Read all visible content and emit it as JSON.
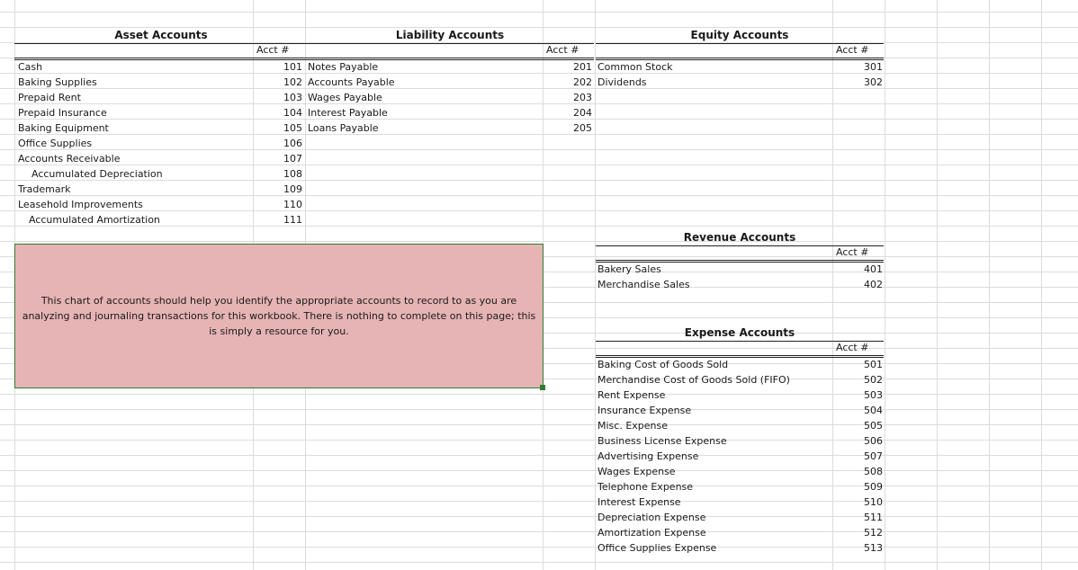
{
  "asset": {
    "title": "Asset Accounts",
    "acct_label": "Acct #",
    "rows": [
      {
        "name": "Cash",
        "num": "101"
      },
      {
        "name": "Baking Supplies",
        "num": "102"
      },
      {
        "name": "Prepaid Rent",
        "num": "103"
      },
      {
        "name": "Prepaid Insurance",
        "num": "104"
      },
      {
        "name": "Baking Equipment",
        "num": "105"
      },
      {
        "name": "Office Supplies",
        "num": "106"
      },
      {
        "name": "Accounts Receivable",
        "num": "107"
      },
      {
        "name": "Accumulated Depreciation",
        "num": "108"
      },
      {
        "name": "Trademark",
        "num": "109"
      },
      {
        "name": "Leasehold Improvements",
        "num": "110"
      },
      {
        "name": "Accumulated Amortization",
        "num": "111"
      }
    ]
  },
  "liability": {
    "title": "Liability Accounts",
    "acct_label": "Acct #",
    "rows": [
      {
        "name": "Notes Payable",
        "num": "201"
      },
      {
        "name": "Accounts Payable",
        "num": "202"
      },
      {
        "name": "Wages Payable",
        "num": "203"
      },
      {
        "name": "Interest Payable",
        "num": "204"
      },
      {
        "name": "Loans Payable",
        "num": "205"
      }
    ]
  },
  "equity": {
    "title": "Equity Accounts",
    "acct_label": "Acct #",
    "rows": [
      {
        "name": "Common Stock",
        "num": "301"
      },
      {
        "name": "Dividends",
        "num": "302"
      }
    ]
  },
  "revenue": {
    "title": "Revenue Accounts",
    "acct_label": "Acct #",
    "rows": [
      {
        "name": "Bakery Sales",
        "num": "401"
      },
      {
        "name": "Merchandise Sales",
        "num": "402"
      }
    ]
  },
  "expense": {
    "title": "Expense Accounts",
    "acct_label": "Acct #",
    "rows": [
      {
        "name": "Baking Cost of Goods Sold",
        "num": "501"
      },
      {
        "name": "Merchandise Cost of Goods Sold (FIFO)",
        "num": "502"
      },
      {
        "name": "Rent Expense",
        "num": "503"
      },
      {
        "name": "Insurance Expense",
        "num": "504"
      },
      {
        "name": "Misc. Expense",
        "num": "505"
      },
      {
        "name": "Business License Expense",
        "num": "506"
      },
      {
        "name": "Advertising Expense",
        "num": "507"
      },
      {
        "name": "Wages Expense",
        "num": "508"
      },
      {
        "name": "Telephone Expense",
        "num": "509"
      },
      {
        "name": "Interest Expense",
        "num": "510"
      },
      {
        "name": "Depreciation Expense",
        "num": "511"
      },
      {
        "name": "Amortization Expense",
        "num": "512"
      },
      {
        "name": "Office Supplies Expense",
        "num": "513"
      }
    ]
  },
  "note": {
    "text": "This chart of accounts should help you identify the appropriate accounts to record to as you are analyzing and journaling transactions for this workbook. There is nothing to complete on this page; this is simply a resource for you."
  }
}
